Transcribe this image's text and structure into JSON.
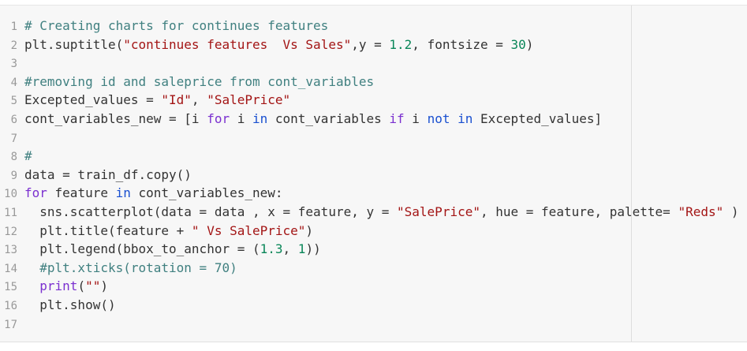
{
  "code": {
    "lines": [
      {
        "n": "1",
        "tokens": [
          {
            "t": "# Creating charts for continues features",
            "k": "comment"
          }
        ]
      },
      {
        "n": "2",
        "tokens": [
          {
            "t": "plt.suptitle(",
            "k": "plain"
          },
          {
            "t": "\"continues features  Vs Sales\"",
            "k": "str"
          },
          {
            "t": ",y = ",
            "k": "plain"
          },
          {
            "t": "1.2",
            "k": "num"
          },
          {
            "t": ", fontsize = ",
            "k": "plain"
          },
          {
            "t": "30",
            "k": "num"
          },
          {
            "t": ")",
            "k": "plain"
          }
        ]
      },
      {
        "n": "3",
        "tokens": []
      },
      {
        "n": "4",
        "tokens": [
          {
            "t": "#removing id and saleprice from cont_variables",
            "k": "comment"
          }
        ]
      },
      {
        "n": "5",
        "tokens": [
          {
            "t": "Excepted_values = ",
            "k": "plain"
          },
          {
            "t": "\"Id\"",
            "k": "str"
          },
          {
            "t": ", ",
            "k": "plain"
          },
          {
            "t": "\"SalePrice\"",
            "k": "str"
          }
        ]
      },
      {
        "n": "6",
        "tokens": [
          {
            "t": "cont_variables_new = [i ",
            "k": "plain"
          },
          {
            "t": "for",
            "k": "kw"
          },
          {
            "t": " i ",
            "k": "plain"
          },
          {
            "t": "in",
            "k": "in"
          },
          {
            "t": " cont_variables ",
            "k": "plain"
          },
          {
            "t": "if",
            "k": "kw"
          },
          {
            "t": " i ",
            "k": "plain"
          },
          {
            "t": "not",
            "k": "in"
          },
          {
            "t": " ",
            "k": "plain"
          },
          {
            "t": "in",
            "k": "in"
          },
          {
            "t": " Excepted_values]",
            "k": "plain"
          }
        ]
      },
      {
        "n": "7",
        "tokens": []
      },
      {
        "n": "8",
        "tokens": [
          {
            "t": "#",
            "k": "comment"
          }
        ]
      },
      {
        "n": "9",
        "tokens": [
          {
            "t": "data = train_df.copy()",
            "k": "plain"
          }
        ]
      },
      {
        "n": "10",
        "tokens": [
          {
            "t": "for",
            "k": "kw"
          },
          {
            "t": " feature ",
            "k": "plain"
          },
          {
            "t": "in",
            "k": "in"
          },
          {
            "t": " cont_variables_new:",
            "k": "plain"
          }
        ]
      },
      {
        "n": "11",
        "tokens": [
          {
            "t": "  sns.scatterplot(data = data , x = feature, y = ",
            "k": "plain"
          },
          {
            "t": "\"SalePrice\"",
            "k": "str"
          },
          {
            "t": ", hue = feature, palette= ",
            "k": "plain"
          },
          {
            "t": "\"Reds\"",
            "k": "str"
          },
          {
            "t": " )",
            "k": "plain"
          }
        ]
      },
      {
        "n": "12",
        "tokens": [
          {
            "t": "  plt.title(feature + ",
            "k": "plain"
          },
          {
            "t": "\" Vs SalePrice\"",
            "k": "str"
          },
          {
            "t": ")",
            "k": "plain"
          }
        ]
      },
      {
        "n": "13",
        "tokens": [
          {
            "t": "  plt.legend(bbox_to_anchor = (",
            "k": "plain"
          },
          {
            "t": "1.3",
            "k": "num"
          },
          {
            "t": ", ",
            "k": "plain"
          },
          {
            "t": "1",
            "k": "num"
          },
          {
            "t": "))",
            "k": "plain"
          }
        ]
      },
      {
        "n": "14",
        "tokens": [
          {
            "t": "  #plt.xticks(rotation = 70)",
            "k": "comment"
          }
        ]
      },
      {
        "n": "15",
        "tokens": [
          {
            "t": "  ",
            "k": "plain"
          },
          {
            "t": "print",
            "k": "kw"
          },
          {
            "t": "(",
            "k": "plain"
          },
          {
            "t": "\"\"",
            "k": "str"
          },
          {
            "t": ")",
            "k": "plain"
          }
        ]
      },
      {
        "n": "16",
        "tokens": [
          {
            "t": "  plt.show()",
            "k": "plain"
          }
        ]
      },
      {
        "n": "17",
        "tokens": []
      }
    ]
  },
  "colors": {
    "comment": "#408080",
    "keyword": "#7b30d0",
    "operator_word": "#1a50d0",
    "string": "#a31515",
    "number": "#098658",
    "text": "#333333",
    "line_number": "#999999",
    "background": "#f7f7f7"
  }
}
